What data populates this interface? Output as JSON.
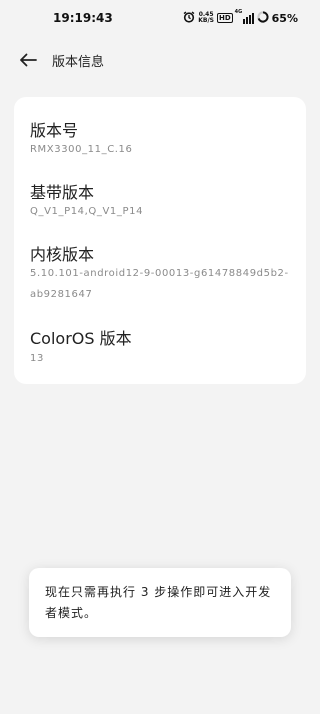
{
  "status": {
    "time": "19:19:43",
    "speed_value": "0.45",
    "speed_unit": "KB/S",
    "hd": "HD",
    "network": "4G",
    "battery": "65%"
  },
  "header": {
    "title": "版本信息"
  },
  "items": [
    {
      "label": "版本号",
      "value": "RMX3300_11_C.16"
    },
    {
      "label": "基带版本",
      "value": "Q_V1_P14,Q_V1_P14"
    },
    {
      "label": "内核版本",
      "value": "5.10.101-android12-9-00013-g61478849d5b2-ab9281647"
    },
    {
      "label": "ColorOS 版本",
      "value": "13"
    }
  ],
  "toast": {
    "text": "现在只需再执行 3 步操作即可进入开发者模式。"
  }
}
